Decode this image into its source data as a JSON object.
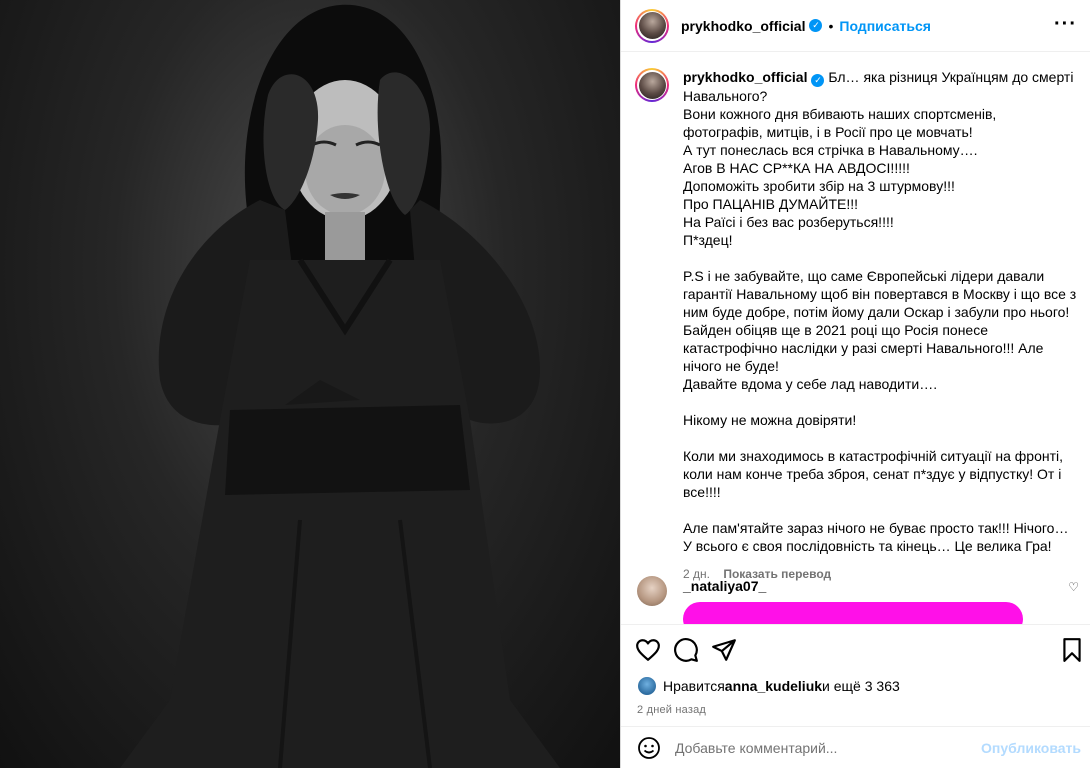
{
  "post": {
    "username": "prykhodko_official",
    "verified_mark": "✓",
    "dot": "•",
    "follow_label": "Подписаться",
    "more_label": "···"
  },
  "caption": {
    "username": "prykhodko_official",
    "text": " Бл… яка різниця Українцям до смерті Навального?\nВони кожного дня вбивають наших спортсменів, фотографів, митців, і в Росії про це мовчать!\nА тут понеслась вся стрічка в Навальному….\nАгов В НАС СР**КА НА АВДОСІ!!!!!\nДопоможіть зробити збір на 3 штурмову!!!\nПро ПАЦАНІВ ДУМАЙТЕ!!!\nНа Раїсі і без вас розберуться!!!!\nП*здец!\n\nP.S і не забувайте, що саме Європейські лідери давали гарантії Навальному щоб він повертався в Москву і що все з ним буде добре, потім йому дали Оскар і забули про нього!\nБайден обіцяв ще в 2021 році що Росія понесе катастрофічно наслідки у разі смерті Навального!!! Але нічого не буде!\nДавайте вдома у себе лад наводити….\n\nНікому не можна довіряти!\n\nКоли ми знаходимось в катастрофічній ситуації на фронті, коли нам конче треба зброя, сенат п*здує у відпустку! От і все!!!!\n\nАле пам'ятайте зараз нічого не буває просто так!!! Нічого… У всього є своя послідовність та кінець… Це велика Гра!",
    "time": "2 дн.",
    "translate_label": "Показать перевод"
  },
  "comment": {
    "username": "_nataliya07_",
    "heart": "♡"
  },
  "likes": {
    "prefix": "Нравится ",
    "user": "anna_kudeliuk",
    "suffix": " и ещё 3 363"
  },
  "timestamp": "2 дней назад",
  "comment_input": {
    "placeholder": "Добавьте комментарий...",
    "publish_label": "Опубликовать"
  },
  "colors": {
    "accent": "#0095f6",
    "publish_disabled": "#b3dbff",
    "comment_bar": "#ff10e8"
  },
  "icons": [
    "heart-icon",
    "comment-icon",
    "share-icon",
    "bookmark-icon",
    "emoji-icon",
    "verified-icon",
    "more-icon"
  ]
}
